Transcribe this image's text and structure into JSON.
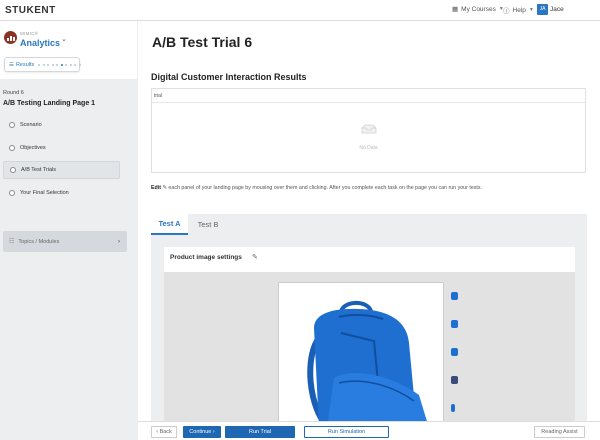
{
  "header": {
    "logo": "STUKENT",
    "my_courses": "My Courses",
    "help": "Help",
    "avatar_initials": "JA",
    "username": "Jace"
  },
  "sidebar": {
    "course_subtitle": "MIMIC®",
    "course_name": "Analytics",
    "results_label": "Results",
    "progress_dots_filled": 6,
    "progress_dots_total": 10,
    "round_label": "Round 6",
    "round_title": "A/B Testing Landing Page 1",
    "items": [
      {
        "label": "Scenario",
        "active": false
      },
      {
        "label": "Objectives",
        "active": false
      },
      {
        "label": "A/B Test Trials",
        "active": true
      },
      {
        "label": "Your Final Selection",
        "active": false
      }
    ],
    "topics_label": "Topics / Modules"
  },
  "main": {
    "page_title": "A/B Test Trial 6",
    "section_title": "Digital Customer Interaction Results",
    "results_header": "trial",
    "no_data": "No Data",
    "edit_hint_bold": "Edit",
    "edit_hint_rest": " each panel of your landing page by mousing over them and clicking. After you complete each task on the page you can run your tests.",
    "tabs": [
      {
        "label": "Test A",
        "active": true
      },
      {
        "label": "Test B",
        "active": false
      }
    ],
    "panel_title": "Product image settings"
  },
  "footer": {
    "back": "‹ Back",
    "continue": "Continue ›",
    "run_trial": "Run Trial",
    "run_simulation": "Run Simulation",
    "reading_assist": "Reading Assist"
  },
  "colors": {
    "accent": "#2b77c1",
    "button_blue": "#1f66b3",
    "backpack_blue": "#1f6fd1",
    "course_icon": "#8a3324"
  }
}
